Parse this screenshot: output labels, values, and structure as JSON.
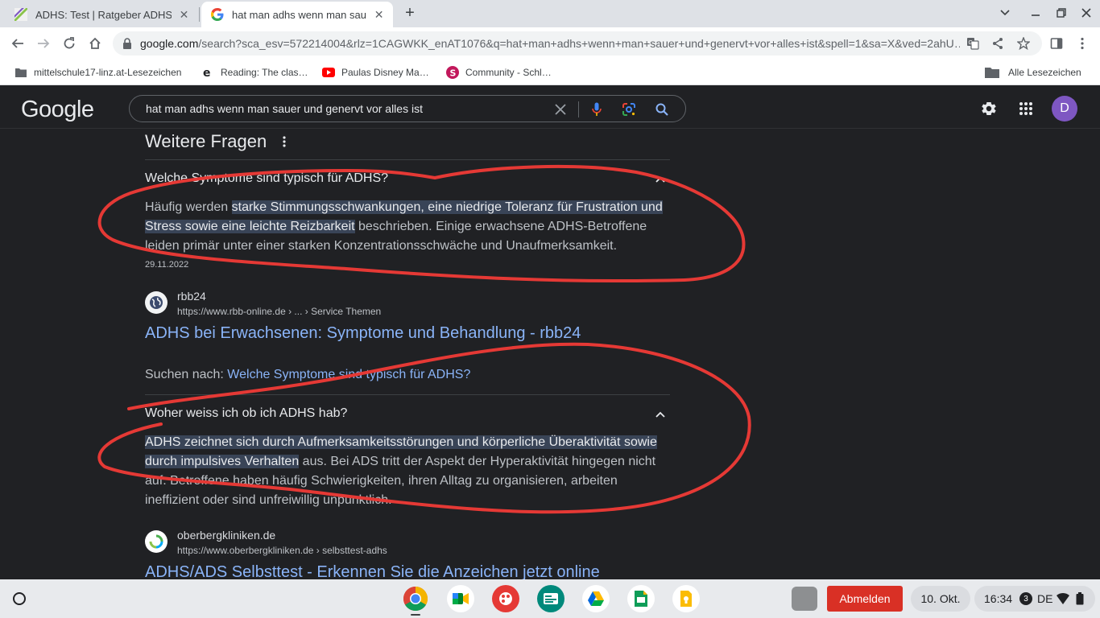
{
  "browser": {
    "tabs": [
      {
        "title": "ADHS: Test | Ratgeber ADHS",
        "active": false
      },
      {
        "title": "hat man adhs wenn man sauer und genervt",
        "active": true
      }
    ],
    "url_host": "google.com",
    "url_path": "/search?sca_esv=572214004&rlz=1CAGWKK_enAT1076&q=hat+man+adhs+wenn+man+sauer+und+genervt+vor+alles+ist&spell=1&sa=X&ved=2ahU…",
    "bookmarks": [
      {
        "label": "mittelschule17-linz.at-Lesezeichen",
        "icon": "folder-icon"
      },
      {
        "label": "Reading: The clas…",
        "icon": "e-icon"
      },
      {
        "label": "Paulas Disney Ma…",
        "icon": "youtube-icon"
      },
      {
        "label": "Community - Schl…",
        "icon": "s-icon"
      }
    ],
    "all_bookmarks": "Alle Lesezeichen"
  },
  "google": {
    "logo": "Google",
    "query": "hat man adhs wenn man sauer und genervt vor alles ist",
    "avatar_letter": "D"
  },
  "results": {
    "section_title": "Weitere Fragen",
    "q1": {
      "question": "Welche Symptome sind typisch für ADHS?",
      "answer_pre": "Häufig werden ",
      "answer_highlight": "starke Stimmungsschwankungen, eine niedrige Toleranz für Frustration und Stress sowie eine leichte Reizbarkeit",
      "answer_post": " beschrieben. Einige erwachsene ADHS-Betroffene leiden primär unter einer starken Konzentrationsschwäche und Unaufmerksamkeit.",
      "date": "29.11.2022",
      "source_name": "rbb24",
      "source_url": "https://www.rbb-online.de › ... › Service Themen",
      "result_title": "ADHS bei Erwachsenen: Symptome und Behandlung - rbb24",
      "search_for_label": "Suchen nach: ",
      "search_for_link": "Welche Symptome sind typisch für ADHS?"
    },
    "q2": {
      "question": "Woher weiss ich ob ich ADHS hab?",
      "answer_highlight": "ADHS zeichnet sich durch Aufmerksamkeitsstörungen und körperliche Überaktivität sowie durch impulsives Verhalten",
      "answer_post": " aus. Bei ADS tritt der Aspekt der Hyperaktivität hingegen nicht auf. Betroffene haben häufig Schwierigkeiten, ihren Alltag zu organisieren, arbeiten ineffizient oder sind unfreiwillig unpünktlich.",
      "source_name": "oberbergkliniken.de",
      "source_url": "https://www.oberbergkliniken.de › selbsttest-adhs",
      "result_title": "ADHS/ADS Selbsttest - Erkennen Sie die Anzeichen jetzt online"
    }
  },
  "shelf": {
    "apps": [
      "chrome-icon",
      "meet-icon",
      "canvas-icon",
      "classroom-icon",
      "drive-icon",
      "slides-icon",
      "keep-icon"
    ],
    "logout": "Abmelden",
    "date": "10. Okt.",
    "time": "16:34",
    "notifications": "3",
    "lang": "DE"
  },
  "colors": {
    "annotation": "#e53935",
    "link": "#8ab4f8",
    "highlight": "#394457",
    "logout": "#d93025"
  }
}
